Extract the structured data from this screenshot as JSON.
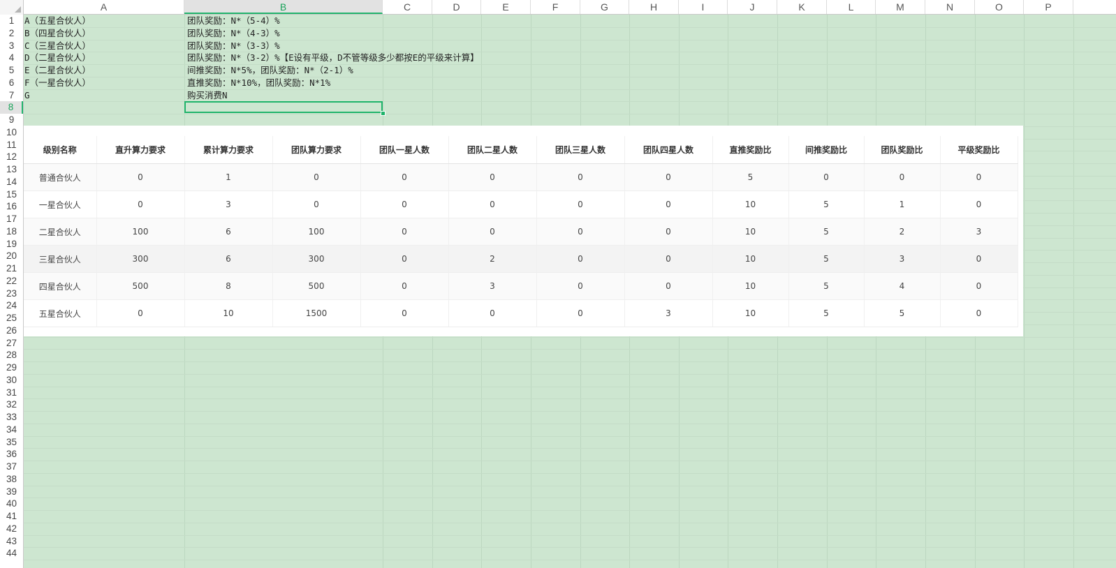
{
  "sheet": {
    "columns": [
      "A",
      "B",
      "C",
      "D",
      "E",
      "F",
      "G",
      "H",
      "I",
      "J",
      "K",
      "L",
      "M",
      "N",
      "O",
      "P"
    ],
    "active_column": "B",
    "rows": [
      "1",
      "2",
      "3",
      "4",
      "5",
      "6",
      "7",
      "8",
      "9",
      "10",
      "11",
      "12",
      "13",
      "14",
      "15",
      "16",
      "17",
      "18",
      "19",
      "20",
      "21",
      "22",
      "23",
      "24",
      "25",
      "26",
      "27",
      "28",
      "29",
      "30",
      "31",
      "32",
      "33",
      "34",
      "35",
      "36",
      "37",
      "38",
      "39",
      "40",
      "41",
      "42",
      "43",
      "44"
    ],
    "active_row": "8",
    "col_a": [
      "A（五星合伙人）",
      "B（四星合伙人）",
      "C（三星合伙人）",
      "D（二星合伙人）",
      "E（二星合伙人）",
      "F（一星合伙人）",
      "G"
    ],
    "col_b": [
      "团队奖励：N*（5-4）%",
      "团队奖励：N*（4-3）%",
      "团队奖励：N*（3-3）%",
      "团队奖励：N*（3-2）%【E设有平级，D不管等级多少都按E的平级来计算】",
      "间推奖励：N*5%，团队奖励：N*（2-1）%",
      "直推奖励：N*10%，团队奖励：N*1%",
      "购买消费N"
    ]
  },
  "rank_table": {
    "headers": [
      "级别名称",
      "直升算力要求",
      "累计算力要求",
      "团队算力要求",
      "团队一星人数",
      "团队二星人数",
      "团队三星人数",
      "团队四星人数",
      "直推奖励比",
      "间推奖励比",
      "团队奖励比",
      "平级奖励比"
    ],
    "rows": [
      [
        "普通合伙人",
        "0",
        "1",
        "0",
        "0",
        "0",
        "0",
        "0",
        "5",
        "0",
        "0",
        "0"
      ],
      [
        "一星合伙人",
        "0",
        "3",
        "0",
        "0",
        "0",
        "0",
        "0",
        "10",
        "5",
        "1",
        "0"
      ],
      [
        "二星合伙人",
        "100",
        "6",
        "100",
        "0",
        "0",
        "0",
        "0",
        "10",
        "5",
        "2",
        "3"
      ],
      [
        "三星合伙人",
        "300",
        "6",
        "300",
        "0",
        "2",
        "0",
        "0",
        "10",
        "5",
        "3",
        "0"
      ],
      [
        "四星合伙人",
        "500",
        "8",
        "500",
        "0",
        "3",
        "0",
        "0",
        "10",
        "5",
        "4",
        "0"
      ],
      [
        "五星合伙人",
        "0",
        "10",
        "1500",
        "0",
        "0",
        "0",
        "3",
        "10",
        "5",
        "5",
        "0"
      ]
    ]
  }
}
